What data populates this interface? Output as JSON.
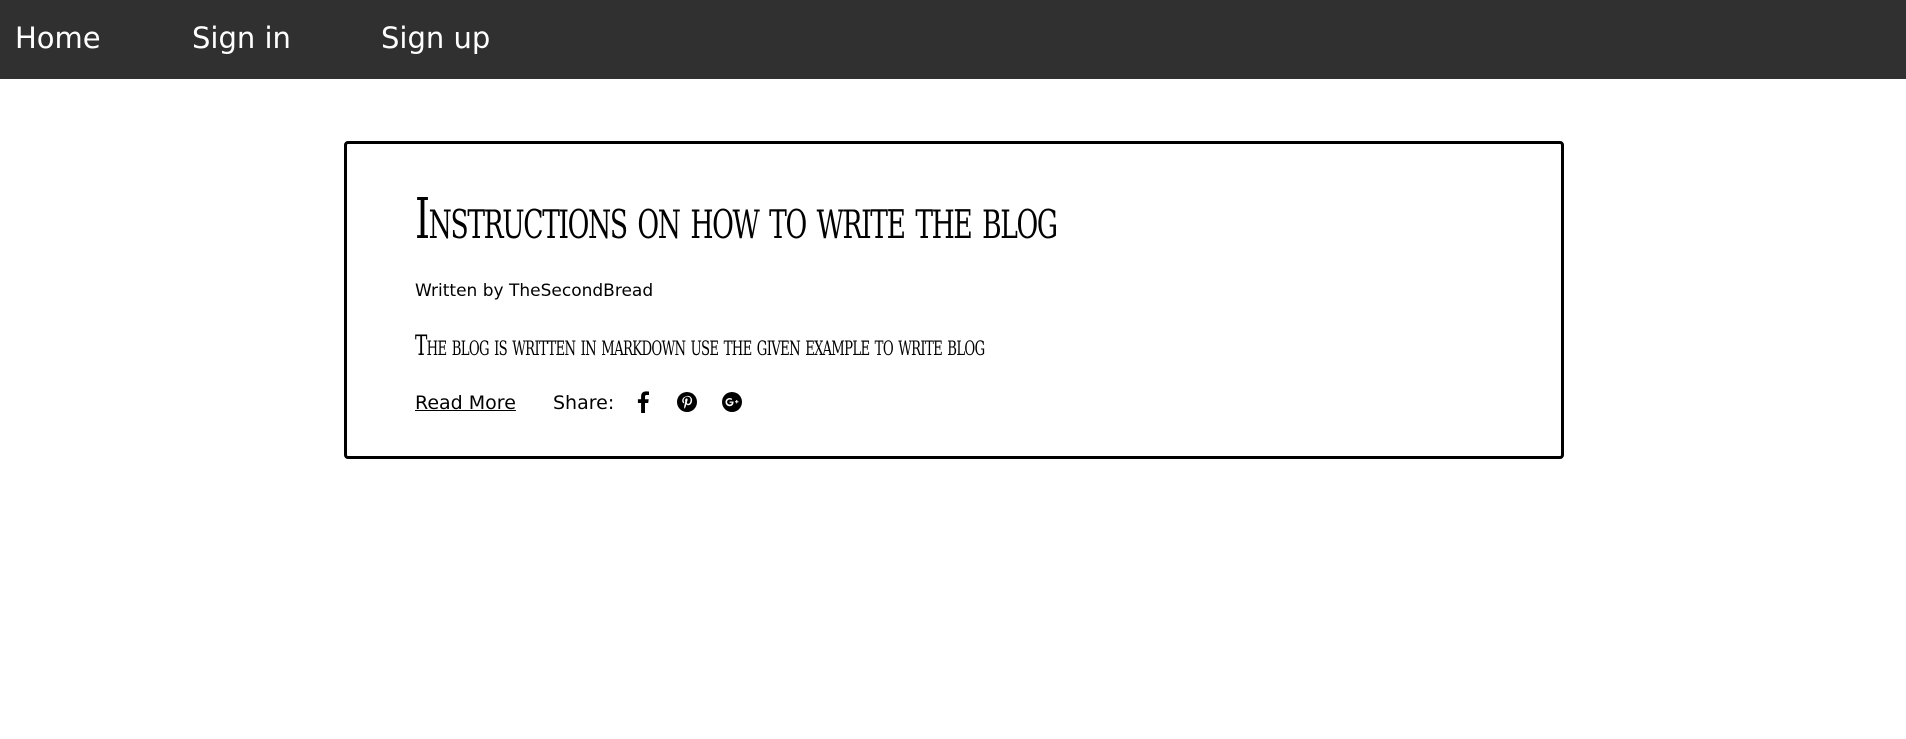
{
  "nav": {
    "home": "Home",
    "sign_in": "Sign in",
    "sign_up": "Sign up"
  },
  "post": {
    "title": "Instructions on how to write the blog",
    "author": "Written by TheSecondBread",
    "excerpt": "The blog is written in markdown use the given example to write blog",
    "read_more": "Read More",
    "share_label": "Share:",
    "share_icons": [
      "facebook-icon",
      "pinterest-icon",
      "google-plus-icon"
    ]
  },
  "colors": {
    "navbar_bg": "#303030",
    "nav_text": "#ffffff",
    "card_border": "#000000",
    "page_bg": "#ffffff"
  }
}
